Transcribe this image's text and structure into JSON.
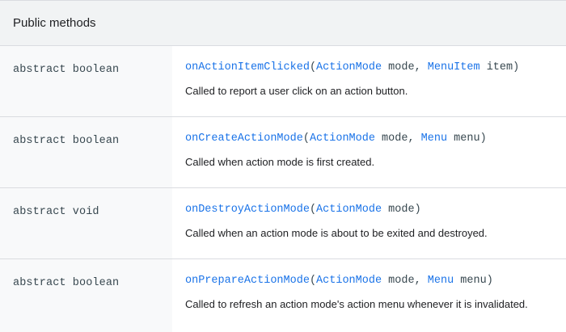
{
  "header": {
    "title": "Public methods"
  },
  "rows": [
    {
      "type": "abstract boolean",
      "method": "onActionItemClicked",
      "p1_type": "ActionMode",
      "p1_name": " mode, ",
      "p2_type": "MenuItem",
      "p2_name": " item",
      "desc": "Called to report a user click on an action button."
    },
    {
      "type": "abstract boolean",
      "method": "onCreateActionMode",
      "p1_type": "ActionMode",
      "p1_name": " mode, ",
      "p2_type": "Menu",
      "p2_name": " menu",
      "desc": "Called when action mode is first created."
    },
    {
      "type": "abstract void",
      "method": "onDestroyActionMode",
      "p1_type": "ActionMode",
      "p1_name": " mode",
      "desc": "Called when an action mode is about to be exited and destroyed."
    },
    {
      "type": "abstract boolean",
      "method": "onPrepareActionMode",
      "p1_type": "ActionMode",
      "p1_name": " mode, ",
      "p2_type": "Menu",
      "p2_name": " menu",
      "desc": "Called to refresh an action mode's action menu whenever it is invalidated."
    }
  ],
  "punct": {
    "open": "(",
    "close": ")"
  },
  "colors": {
    "link": "#1a73e8",
    "header_bg": "#f1f3f4",
    "type_bg": "#f8f9fa",
    "border": "#dadce0"
  }
}
